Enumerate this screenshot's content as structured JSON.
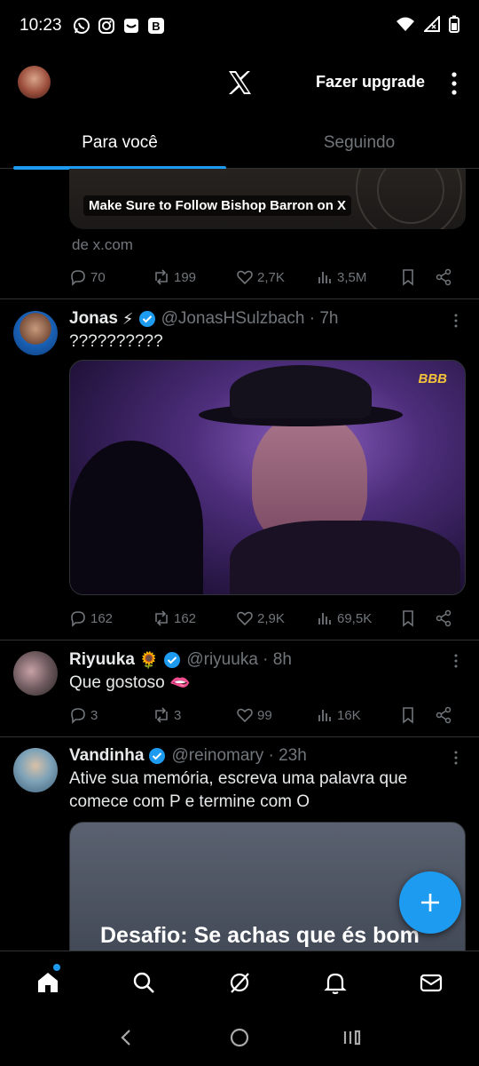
{
  "status_bar": {
    "time": "10:23",
    "app_icons": [
      "whatsapp-icon",
      "instagram-icon",
      "inbox-icon",
      "b-app-icon"
    ],
    "b_app_letter": "B"
  },
  "header": {
    "upgrade_label": "Fazer upgrade"
  },
  "tabs": [
    {
      "label": "Para você",
      "active": true
    },
    {
      "label": "Seguindo",
      "active": false
    }
  ],
  "previous_post": {
    "card_caption": "Make Sure to Follow Bishop Barron on X",
    "from_link": "de x.com",
    "replies": "70",
    "reposts": "199",
    "likes": "2,7K",
    "views": "3,5M"
  },
  "tweets": [
    {
      "name": "Jonas",
      "emoji": "⚡",
      "handle": "@JonasHSulzbach · 7h",
      "text": "??????????",
      "media_badge": "BBB",
      "replies": "162",
      "reposts": "162",
      "likes": "2,9K",
      "views": "69,5K"
    },
    {
      "name": "Riyuuka",
      "emoji": "🌻",
      "handle": "@riyuuka · 8h",
      "text": "Que gostoso 🫦",
      "replies": "3",
      "reposts": "3",
      "likes": "99",
      "views": "16K"
    },
    {
      "name": "Vandinha",
      "handle": "@reinomary · 23h",
      "text": "Ative sua memória, escreva uma palavra que comece com P e termine com O",
      "media_caption": "Desafio: Se achas que és bom"
    }
  ],
  "colors": {
    "accent": "#1d9bf0",
    "background": "#000000",
    "muted": "#71767b",
    "divider": "#2f3336"
  },
  "bottom_nav": [
    "home-icon",
    "search-icon",
    "grok-icon",
    "notifications-icon",
    "messages-icon"
  ],
  "system_nav": [
    "back-icon",
    "home-circle-icon",
    "recents-icon"
  ]
}
